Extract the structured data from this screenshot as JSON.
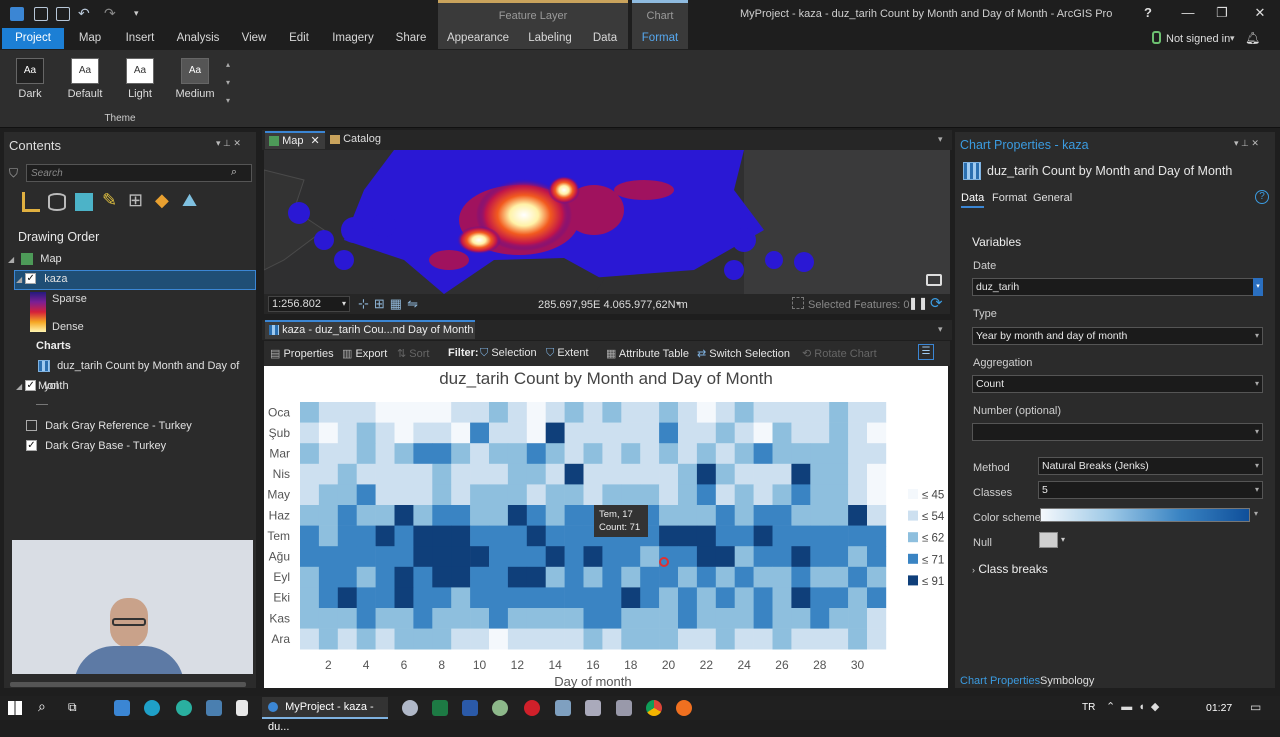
{
  "app": {
    "window_title": "MyProject - kaza - duz_tarih Count by Month and Day of Month - ArcGIS Pro",
    "signed_in": "Not signed in",
    "context_group_1": "Feature Layer",
    "context_group_2": "Chart"
  },
  "ribbon_tabs": [
    "Project",
    "Map",
    "Insert",
    "Analysis",
    "View",
    "Edit",
    "Imagery",
    "Share",
    "Appearance",
    "Labeling",
    "Data",
    "Format"
  ],
  "themes": {
    "group_label": "Theme",
    "items": [
      "Dark",
      "Default",
      "Light",
      "Medium"
    ]
  },
  "contents": {
    "title": "Contents",
    "search_placeholder": "Search",
    "drawing_order": "Drawing Order",
    "map": "Map",
    "layer_kaza": "kaza",
    "sparse": "Sparse",
    "dense": "Dense",
    "charts": "Charts",
    "chart_item": "duz_tarih Count by Month and Day of Month",
    "layer_yol": "yol",
    "layer_ref": "Dark Gray Reference - Turkey",
    "layer_base": "Dark Gray Base - Turkey"
  },
  "map_view": {
    "tab_map": "Map",
    "tab_catalog": "Catalog",
    "scale": "1:256.802",
    "coords": "285.697,95E 4.065.977,62N m",
    "selected": "Selected Features: 0"
  },
  "chart_view": {
    "tab": "kaza - duz_tarih Cou...nd Day of Month",
    "toolbar": {
      "properties": "Properties",
      "export": "Export",
      "sort": "Sort",
      "filter": "Filter:",
      "selection": "Selection",
      "extent": "Extent",
      "attribute_table": "Attribute Table",
      "switch_selection": "Switch Selection",
      "rotate": "Rotate Chart"
    },
    "tooltip_line1": "Tem, 17",
    "tooltip_line2": "Count: 71"
  },
  "chart_data": {
    "type": "heatmap",
    "title": "duz_tarih Count by Month and Day of Month",
    "xlabel": "Day of month",
    "ylabel": "",
    "months": [
      "Oca",
      "Şub",
      "Mar",
      "Nis",
      "May",
      "Haz",
      "Tem",
      "Ağu",
      "Eyl",
      "Eki",
      "Kas",
      "Ara"
    ],
    "x_ticks": [
      2,
      4,
      6,
      8,
      10,
      12,
      14,
      16,
      18,
      20,
      22,
      24,
      26,
      28,
      30
    ],
    "classes": [
      "≤ 45",
      "≤ 54",
      "≤ 62",
      "≤ 71",
      "≤ 91"
    ],
    "class_colors": [
      "#f4f8fc",
      "#cde0f0",
      "#8ebfde",
      "#3a84c3",
      "#0f3f7a"
    ],
    "grid": [
      [
        2,
        1,
        1,
        1,
        0,
        0,
        0,
        0,
        1,
        1,
        2,
        1,
        0,
        1,
        2,
        1,
        2,
        1,
        1,
        2,
        1,
        0,
        1,
        2,
        1,
        1,
        1,
        1,
        2,
        1,
        1
      ],
      [
        1,
        0,
        1,
        2,
        1,
        0,
        1,
        1,
        0,
        3,
        1,
        1,
        0,
        4,
        1,
        1,
        1,
        1,
        1,
        3,
        1,
        1,
        2,
        1,
        0,
        2,
        1,
        1,
        2,
        1,
        0
      ],
      [
        2,
        1,
        1,
        2,
        1,
        2,
        3,
        3,
        2,
        1,
        2,
        2,
        3,
        2,
        1,
        2,
        1,
        2,
        1,
        2,
        1,
        2,
        1,
        2,
        3,
        2,
        2,
        2,
        2,
        1,
        1
      ],
      [
        1,
        1,
        2,
        1,
        1,
        1,
        1,
        2,
        1,
        1,
        1,
        2,
        2,
        1,
        4,
        1,
        1,
        1,
        1,
        1,
        2,
        4,
        2,
        1,
        1,
        1,
        4,
        2,
        2,
        1,
        0
      ],
      [
        1,
        2,
        2,
        3,
        1,
        1,
        1,
        2,
        1,
        2,
        2,
        2,
        1,
        2,
        2,
        1,
        2,
        2,
        2,
        1,
        2,
        3,
        1,
        2,
        1,
        2,
        3,
        2,
        2,
        1,
        0
      ],
      [
        2,
        2,
        3,
        2,
        2,
        4,
        2,
        3,
        3,
        2,
        2,
        4,
        3,
        2,
        3,
        3,
        2,
        2,
        3,
        2,
        2,
        2,
        3,
        2,
        3,
        3,
        2,
        2,
        2,
        4,
        1
      ],
      [
        3,
        2,
        3,
        3,
        4,
        3,
        4,
        4,
        4,
        3,
        3,
        3,
        4,
        3,
        3,
        3,
        3,
        3,
        3,
        4,
        4,
        4,
        3,
        3,
        4,
        3,
        3,
        3,
        3,
        3,
        3
      ],
      [
        3,
        3,
        3,
        3,
        3,
        3,
        4,
        4,
        4,
        4,
        3,
        3,
        3,
        4,
        3,
        4,
        3,
        3,
        2,
        3,
        3,
        4,
        4,
        2,
        3,
        3,
        4,
        3,
        3,
        2,
        3
      ],
      [
        2,
        3,
        3,
        2,
        3,
        4,
        3,
        4,
        4,
        3,
        3,
        4,
        4,
        2,
        3,
        2,
        3,
        2,
        3,
        3,
        2,
        3,
        2,
        3,
        2,
        2,
        3,
        2,
        2,
        3,
        2
      ],
      [
        2,
        3,
        4,
        3,
        3,
        4,
        3,
        3,
        2,
        3,
        3,
        3,
        3,
        3,
        3,
        3,
        3,
        4,
        3,
        2,
        3,
        2,
        3,
        2,
        3,
        2,
        4,
        3,
        3,
        2,
        3
      ],
      [
        2,
        2,
        2,
        3,
        2,
        2,
        3,
        2,
        2,
        2,
        3,
        2,
        2,
        2,
        2,
        3,
        3,
        2,
        2,
        2,
        3,
        2,
        2,
        2,
        3,
        2,
        2,
        3,
        2,
        2,
        1
      ],
      [
        1,
        2,
        1,
        2,
        1,
        2,
        2,
        2,
        1,
        1,
        0,
        1,
        1,
        1,
        1,
        2,
        1,
        2,
        2,
        2,
        1,
        1,
        2,
        1,
        1,
        2,
        1,
        1,
        1,
        2,
        1
      ]
    ]
  },
  "properties": {
    "title": "Chart Properties - kaza",
    "chart_name": "duz_tarih Count by Month and Day of Month",
    "tabs": [
      "Data",
      "Format",
      "General"
    ],
    "variables": "Variables",
    "date_label": "Date",
    "date_value": "duz_tarih",
    "type_label": "Type",
    "type_value": "Year by month and day of month",
    "agg_label": "Aggregation",
    "agg_value": "Count",
    "number_label": "Number (optional)",
    "number_value": "",
    "method_label": "Method",
    "method_value": "Natural Breaks (Jenks)",
    "classes_label": "Classes",
    "classes_value": "5",
    "scheme_label": "Color scheme",
    "null_label": "Null",
    "class_breaks": "Class breaks",
    "bottom_tab_1": "Chart Properties",
    "bottom_tab_2": "Symbology"
  },
  "taskbar": {
    "active_app": "MyProject - kaza - du...",
    "lang": "TR",
    "time": "01:27"
  }
}
